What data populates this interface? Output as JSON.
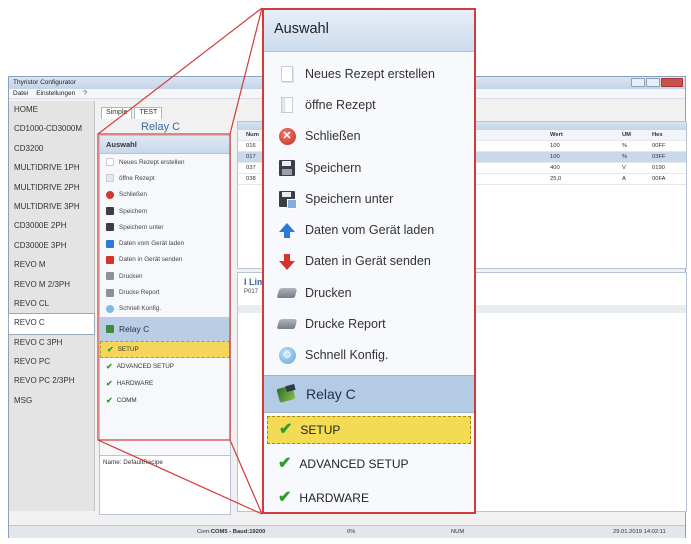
{
  "window": {
    "title": "Thyristor Configurator",
    "menu": [
      "Datei",
      "Einstellungen",
      "?"
    ]
  },
  "nav": {
    "items": [
      "HOME",
      "CD1000-CD3000M",
      "CD3200",
      "MULTIDRIVE 1PH",
      "MULTIDRIVE 2PH",
      "MULTIDRIVE 3PH",
      "CD3000E 2PH",
      "CD3000E 3PH",
      "REVO M",
      "REVO M 2/3PH",
      "REVO CL",
      "REVO C",
      "REVO C 3PH",
      "REVO PC",
      "REVO PC 2/3PH",
      "MSG"
    ],
    "selected": "REVO C"
  },
  "tabs": [
    "Simple",
    "TEST"
  ],
  "device_title": "Relay C",
  "panel": {
    "header": "Auswahl",
    "actions": [
      {
        "label": "Neues Rezept erstellen",
        "icon": "new-document-icon"
      },
      {
        "label": "öffne Rezept",
        "icon": "open-document-icon"
      },
      {
        "label": "Schließen",
        "icon": "close-circle-icon"
      },
      {
        "label": "Speichern",
        "icon": "save-disk-icon"
      },
      {
        "label": "Speichern unter",
        "icon": "save-as-icon"
      },
      {
        "label": "Daten vom Gerät laden",
        "icon": "arrow-up-icon"
      },
      {
        "label": "Daten in Gerät senden",
        "icon": "arrow-down-icon"
      },
      {
        "label": "Drucken",
        "icon": "printer-icon"
      },
      {
        "label": "Drucke Report",
        "icon": "printer-icon"
      },
      {
        "label": "Schnell Konfig.",
        "icon": "quick-config-icon"
      }
    ],
    "device": "Relay C",
    "categories": [
      "SETUP",
      "ADVANCED SETUP",
      "HARDWARE",
      "COMM"
    ],
    "selected_category": "SETUP"
  },
  "recipe_name": "Name: DefaultRecipe",
  "grid": {
    "headers": {
      "num": "Num",
      "wert": "Wert",
      "um": "UM",
      "hex": "Hex"
    },
    "rows": [
      {
        "num": "016",
        "wert": "100",
        "um": "%",
        "hex": "00FF"
      },
      {
        "num": "017",
        "wert": "100",
        "um": "%",
        "hex": "03FF"
      },
      {
        "num": "037",
        "wert": "400",
        "um": "V",
        "hex": "0190"
      },
      {
        "num": "038",
        "wert": "25,0",
        "um": "A",
        "hex": "00FA"
      }
    ]
  },
  "limits": {
    "title": "I Lim",
    "code": "P017"
  },
  "status": {
    "com_prefix": "Com:",
    "com": "COM5 - Baud:",
    "baud": "19200",
    "progress": "0%",
    "num": "NUM",
    "datetime": "29.01.2019 14:02:11"
  },
  "colors": {
    "accent": "#d33b3b",
    "selection": "#f3dc54",
    "header": "#ccdcee"
  }
}
